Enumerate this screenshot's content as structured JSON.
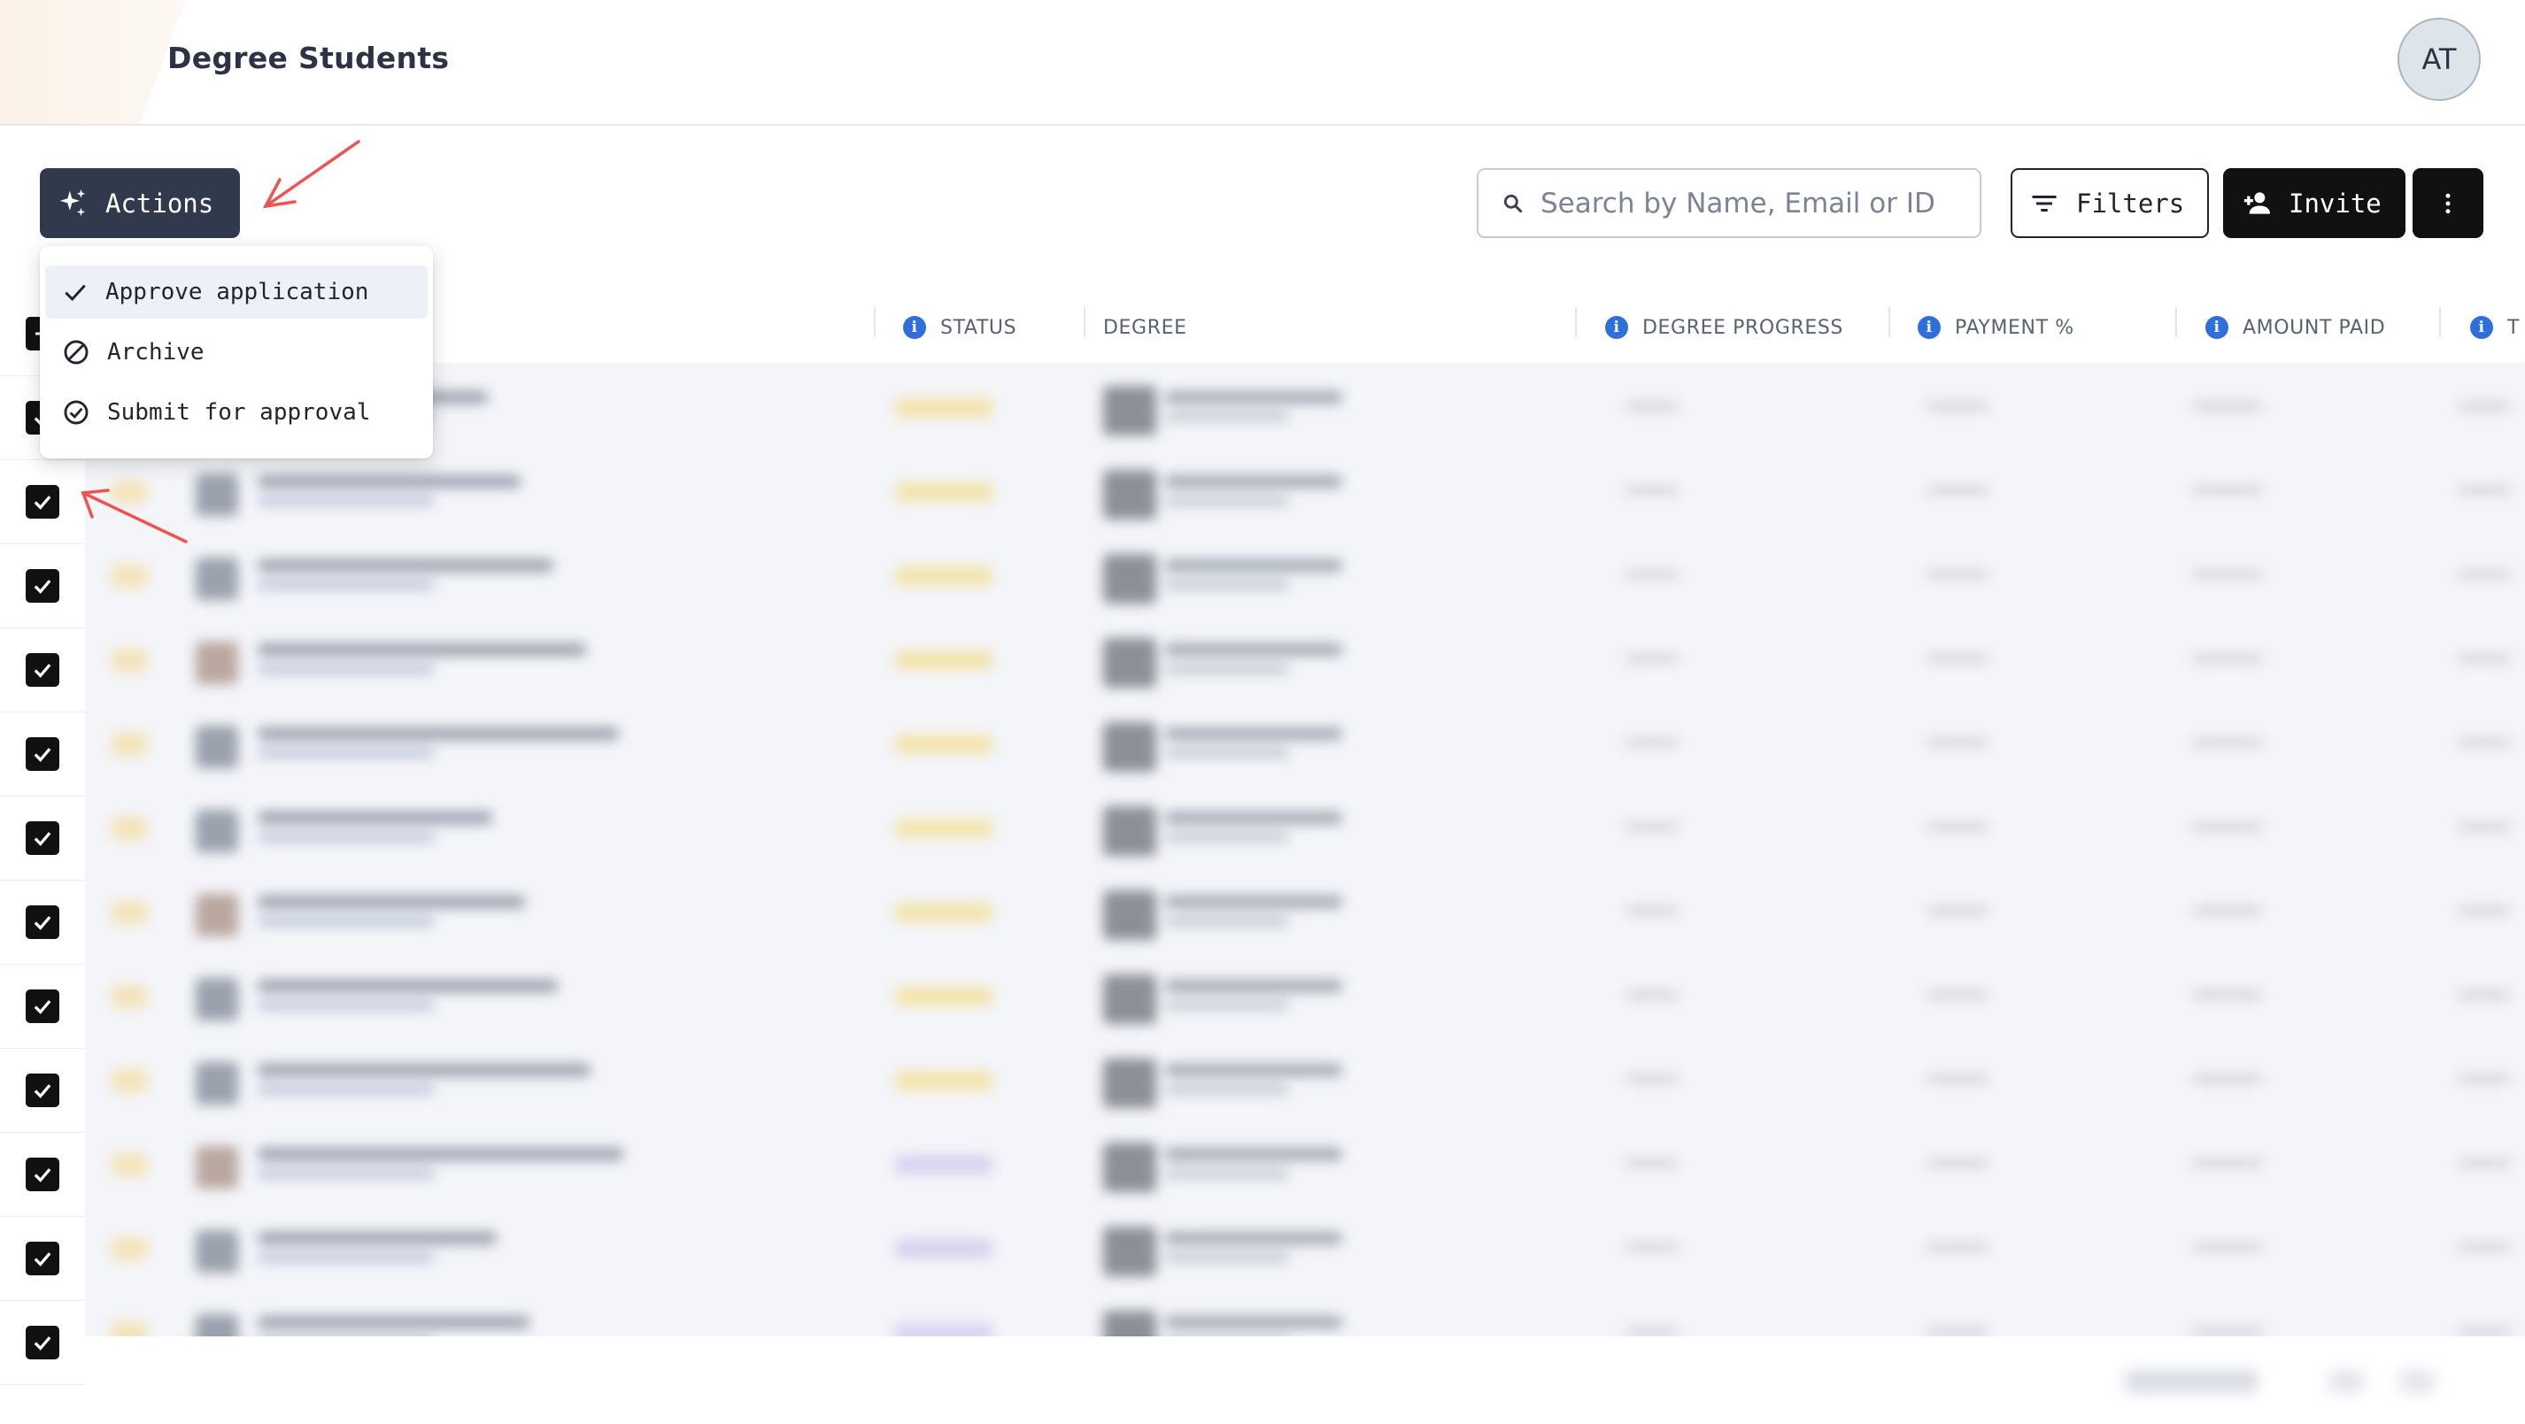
{
  "header": {
    "title": "Degree Students",
    "avatar_initials": "AT"
  },
  "toolbar": {
    "actions_label": "Actions",
    "search_placeholder": "Search by Name, Email or ID",
    "filters_label": "Filters",
    "invite_label": "Invite"
  },
  "actions_menu": {
    "items": [
      {
        "label": "Approve application",
        "icon": "check-icon",
        "highlighted": true
      },
      {
        "label": "Archive",
        "icon": "block-icon"
      },
      {
        "label": "Submit for approval",
        "icon": "check-circle-icon"
      }
    ]
  },
  "table": {
    "columns": [
      "STATUS",
      "DEGREE",
      "DEGREE PROGRESS",
      "PAYMENT %",
      "AMOUNT PAID",
      "T"
    ],
    "rows_checked": [
      true,
      true,
      true,
      true,
      true,
      true,
      true,
      true,
      true,
      true,
      true,
      true
    ]
  },
  "colors": {
    "actions_button": "#313a4d",
    "primary_button": "#111111",
    "info_icon": "#2f6fdc",
    "annotation_arrow": "#ef5350"
  }
}
